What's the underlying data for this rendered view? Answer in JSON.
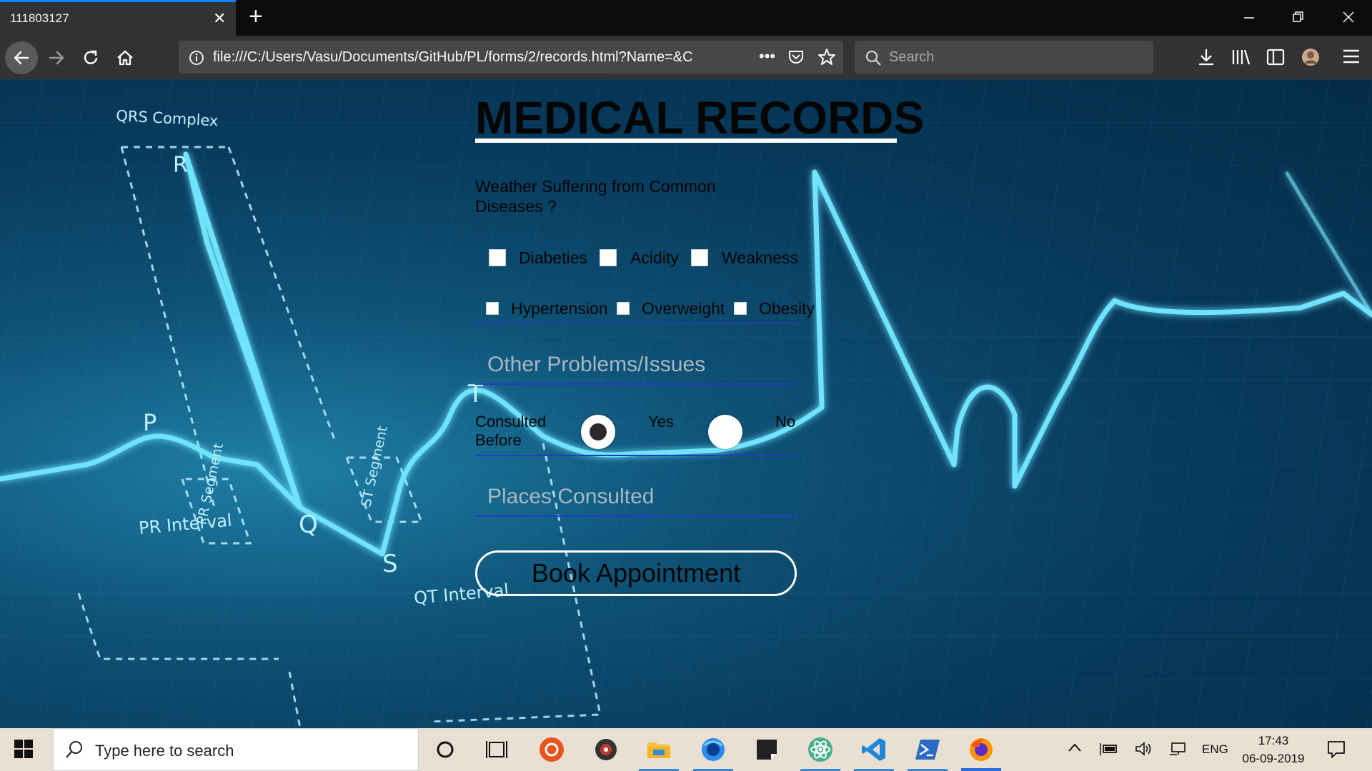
{
  "browser": {
    "tab_title": "111803127",
    "tab_close": "✕",
    "new_tab": "+",
    "url": "file:///C:/Users/Vasu/Documents/GitHub/PL/forms/2/records.html?Name=&C",
    "url_overflow_menu": "•••",
    "search_placeholder": "Search"
  },
  "background_labels": {
    "qrs": "QRS Complex",
    "r": "R",
    "p": "P",
    "q": "Q",
    "s": "S",
    "t": "T",
    "pr_segment": "PR Segment",
    "st_segment": "ST Segment",
    "pr_interval": "PR Interval",
    "qt_interval": "QT Interval"
  },
  "form": {
    "title": "MEDICAL RECORDS",
    "question": "Weather Suffering from Common Diseases ?",
    "diseases_row1": [
      "Diabeties",
      "Acidity",
      "Weakness"
    ],
    "diseases_row2": [
      "Hypertension",
      "Overweight",
      "Obesity"
    ],
    "other_placeholder": "Other Problems/Issues",
    "consulted_label_line1": "Consulted",
    "consulted_label_line2": "Before",
    "radio_yes": "Yes",
    "radio_no": "No",
    "radio_selected": "Yes",
    "places_placeholder": "Places Consulted",
    "book_button": "Book Appointment"
  },
  "taskbar": {
    "search_text": "Type here to search",
    "language": "ENG",
    "time": "17:43",
    "date": "06-09-2019"
  },
  "colors": {
    "tab_accent": "#0a84ff",
    "page_bg": "#073a5c",
    "ecg_line": "#6fe3ff",
    "taskbar": "#e9dfd2"
  }
}
